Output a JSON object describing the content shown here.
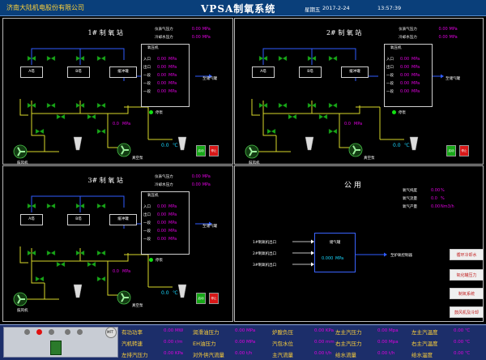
{
  "header": {
    "company": "济南大陆机电股份有限公司",
    "app_title": "VPSA制氧系统",
    "weekday": "星期五",
    "date": "2017-2-24",
    "time": "13:57:39"
  },
  "stations": [
    {
      "title": "1# 制 氧 站",
      "top_readings": [
        {
          "label": "仪表气压力",
          "value": "0.00",
          "unit": "MPa"
        },
        {
          "label": "冷却水压力",
          "value": "0.00",
          "unit": "MPa"
        }
      ],
      "analyzer": {
        "title": "氧压机",
        "rows": [
          {
            "label": "入口",
            "value": "0.00",
            "unit": "MPa"
          },
          {
            "label": "出口",
            "value": "0.00",
            "unit": "MPa"
          },
          {
            "label": "一段",
            "value": "0.00",
            "unit": "MPa"
          },
          {
            "label": "一段",
            "value": "0.00",
            "unit": "MPa"
          },
          {
            "label": "一段",
            "value": "0.00",
            "unit": "MPa"
          }
        ]
      },
      "tanks": [
        "A塔",
        "B塔"
      ],
      "buffer_tank": "缓冲罐",
      "to_label": "至储气罐",
      "status_label": "停泵",
      "pipe_value": {
        "value": "0.0",
        "unit": "MPa"
      },
      "temp": {
        "value": "0.0",
        "unit": "℃"
      },
      "blower_label": "鼓风机",
      "vacuum_label": "真空泵",
      "btn_start": "启动",
      "btn_stop": "停止"
    },
    {
      "title": "2# 制 氧 站",
      "top_readings": [
        {
          "label": "仪表气压力",
          "value": "0.00",
          "unit": "MPa"
        },
        {
          "label": "冷却水压力",
          "value": "0.00",
          "unit": "MPa"
        }
      ],
      "analyzer": {
        "title": "氧压机",
        "rows": [
          {
            "label": "入口",
            "value": "0.00",
            "unit": "MPa"
          },
          {
            "label": "出口",
            "value": "0.00",
            "unit": "MPa"
          },
          {
            "label": "一段",
            "value": "0.00",
            "unit": "MPa"
          },
          {
            "label": "一段",
            "value": "0.00",
            "unit": "MPa"
          },
          {
            "label": "一段",
            "value": "0.00",
            "unit": "MPa"
          }
        ]
      },
      "tanks": [
        "A塔",
        "B塔"
      ],
      "buffer_tank": "缓冲罐",
      "to_label": "至储气罐",
      "status_label": "停泵",
      "pipe_value": {
        "value": "0.0",
        "unit": "MPa"
      },
      "temp": {
        "value": "0.0",
        "unit": "℃"
      },
      "blower_label": "鼓风机",
      "vacuum_label": "真空泵",
      "btn_start": "启动",
      "btn_stop": "停止"
    },
    {
      "title": "3# 制 氧 站",
      "top_readings": [
        {
          "label": "仪表气压力",
          "value": "0.00",
          "unit": "MPa"
        },
        {
          "label": "冷却水压力",
          "value": "0.00",
          "unit": "MPa"
        }
      ],
      "analyzer": {
        "title": "氧压机",
        "rows": [
          {
            "label": "入口",
            "value": "0.00",
            "unit": "MPa"
          },
          {
            "label": "出口",
            "value": "0.00",
            "unit": "MPa"
          },
          {
            "label": "一段",
            "value": "0.00",
            "unit": "MPa"
          },
          {
            "label": "一段",
            "value": "0.00",
            "unit": "MPa"
          },
          {
            "label": "一段",
            "value": "0.00",
            "unit": "MPa"
          }
        ]
      },
      "tanks": [
        "A塔",
        "B塔"
      ],
      "buffer_tank": "缓冲罐",
      "to_label": "至储气罐",
      "status_label": "停泵",
      "pipe_value": {
        "value": "0.0",
        "unit": "MPa"
      },
      "temp": {
        "value": "0.0",
        "unit": "℃"
      },
      "blower_label": "鼓风机",
      "vacuum_label": "真空泵",
      "btn_start": "启动",
      "btn_stop": "停止"
    }
  ],
  "utility": {
    "title": "公 用",
    "readings": [
      {
        "label": "氧气纯度",
        "value": "0.00",
        "unit": "%"
      },
      {
        "label": "氧气流量",
        "value": "0.0",
        "unit": "%"
      },
      {
        "label": "氧气产量",
        "value": "0.00",
        "unit": "Nm3/h"
      }
    ],
    "inputs": [
      "1#制氧机出口",
      "2#制氧机出口",
      "3#制氧机出口"
    ],
    "tank_title": "储气罐",
    "tank_value": {
      "value": "0.000",
      "unit": "MPa"
    },
    "output_label": "至炉氧控制器"
  },
  "side_buttons": [
    "循环冷却水",
    "氧化罐压力",
    "制氧系统",
    "鼓风机及冷却"
  ],
  "bottom": {
    "left_label": "MFT",
    "rows": [
      [
        {
          "label": "有功功率",
          "value": "0.00",
          "unit": "MW"
        },
        {
          "label": "润滑油压力",
          "value": "0.00",
          "unit": "MPa"
        },
        {
          "label": "炉膛负压",
          "value": "0.00",
          "unit": "KPa"
        },
        {
          "label": "左主汽压力",
          "value": "0.00",
          "unit": "Mpa"
        },
        {
          "label": "左主汽温度",
          "value": "0.00",
          "unit": "℃"
        }
      ],
      [
        {
          "label": "汽机转速",
          "value": "0.00",
          "unit": "r/m"
        },
        {
          "label": "EH油压力",
          "value": "0.00",
          "unit": "MPa"
        },
        {
          "label": "汽包水位",
          "value": "0.00",
          "unit": "mm"
        },
        {
          "label": "右主汽压力",
          "value": "0.00",
          "unit": "Mpa"
        },
        {
          "label": "右主汽温度",
          "value": "0.00",
          "unit": "℃"
        }
      ],
      [
        {
          "label": "左排汽压力",
          "value": "0.00",
          "unit": "KPa"
        },
        {
          "label": "对外供汽流量",
          "value": "0.00",
          "unit": "t/h"
        },
        {
          "label": "主汽流量",
          "value": "0.00",
          "unit": "t/h"
        },
        {
          "label": "给水流量",
          "value": "0.00",
          "unit": "t/h"
        },
        {
          "label": "给水温度",
          "value": "0.00",
          "unit": "℃"
        }
      ]
    ]
  },
  "colors": {
    "title_bg": "#0a3f7a",
    "company_text": "#ffd23a",
    "value_magenta": "#e000e0",
    "value_cyan": "#19d8ff",
    "pipe_yellow": "#d8d82a",
    "pipe_blue": "#2f5cff",
    "valve_green": "#18a818"
  }
}
